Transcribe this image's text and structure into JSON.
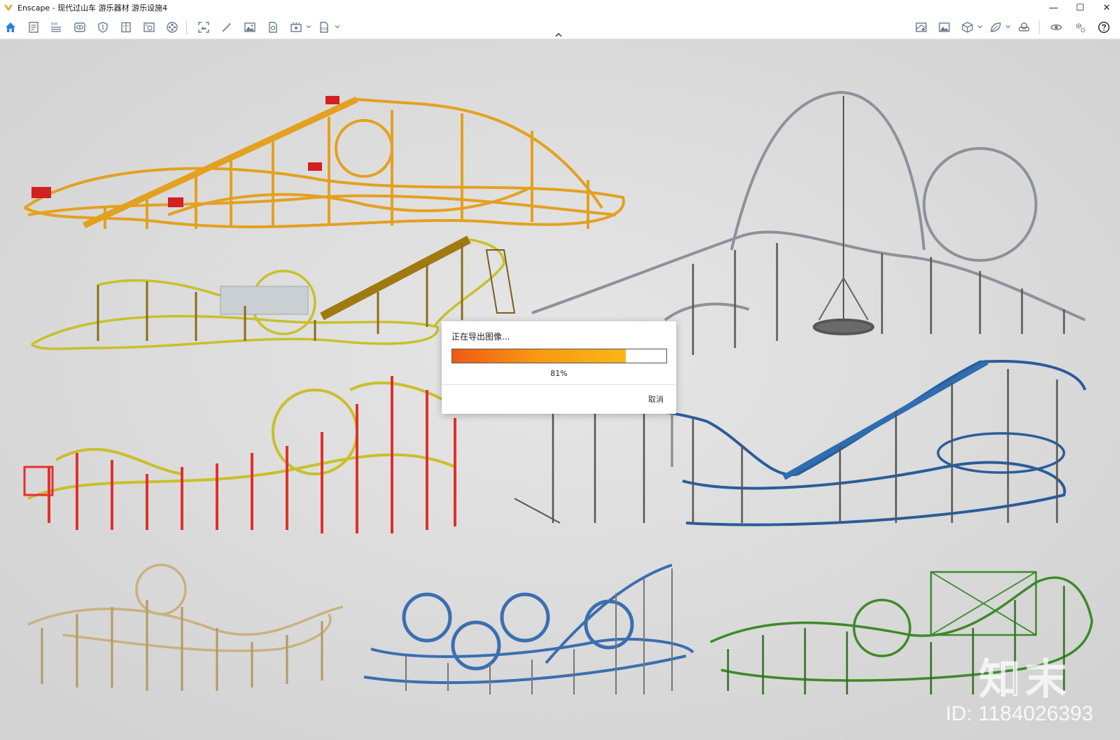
{
  "window": {
    "title": "Enscape - 现代过山车 游乐器材 游乐设施4",
    "minimize": "—",
    "maximize": "☐",
    "close": "✕"
  },
  "colors": {
    "accent": "#f39c12",
    "toolbar_icon": "#6b7a8a",
    "home_icon": "#2f7fd8",
    "progress_start": "#f05a14",
    "progress_end": "#fbb514"
  },
  "toolbar": {
    "left_icons": [
      "home-icon",
      "document-icon",
      "bim-icon",
      "eye-view-icon",
      "shield-icon",
      "book-icon",
      "camera-plus-icon",
      "film-reel-icon"
    ],
    "mid_icons": [
      "screenshot-icon",
      "magic-wand-icon",
      "image-icon",
      "export-icon",
      "batch-render-icon",
      "exe-export-icon"
    ],
    "right_icons": [
      "map-icon",
      "landscape-icon",
      "cube-icon",
      "leaf-icon",
      "vr-headset-icon",
      "visibility-icon",
      "settings-icon",
      "help-icon"
    ]
  },
  "dialog": {
    "title": "正在导出图像...",
    "progress_percent": 81,
    "progress_label": "81%",
    "cancel_label": "取消"
  },
  "watermark": {
    "logo": "知末",
    "id": "ID: 1184026393"
  }
}
